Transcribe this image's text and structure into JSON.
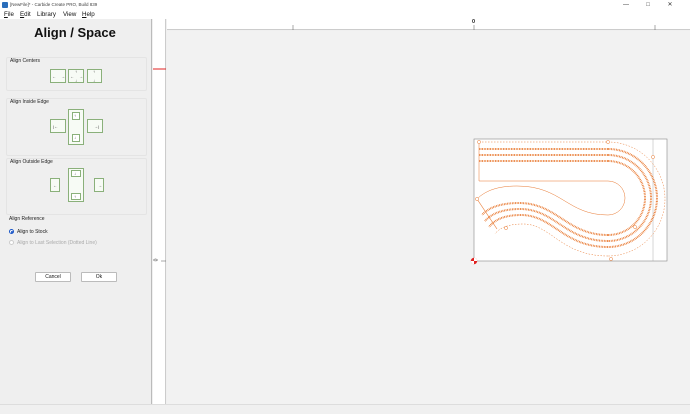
{
  "window": {
    "title": "[NewFile]* - Carbide Create PRO, Build 839",
    "minimize": "—",
    "maximize": "□",
    "close": "✕"
  },
  "menu": {
    "items": [
      {
        "label": "File",
        "key": "F",
        "rest": "ile"
      },
      {
        "label": "Edit",
        "key": "E",
        "rest": "dit"
      },
      {
        "label": "Library",
        "key": "",
        "rest": "Library"
      },
      {
        "label": "View",
        "key": "",
        "rest": "View"
      },
      {
        "label": "Help",
        "key": "H",
        "rest": "elp"
      }
    ]
  },
  "panel": {
    "title": "Align / Space",
    "sections": {
      "centers": "Align Centers",
      "inside": "Align Inside Edge",
      "outside": "Align Outside Edge",
      "reference": "Align Reference"
    },
    "reference_options": [
      {
        "label": "Align to Stock",
        "selected": true,
        "enabled": true
      },
      {
        "label": "Align to Last Selection (Dotted Line)",
        "selected": false,
        "enabled": false
      }
    ],
    "cancel": "Cancel",
    "ok": "Ok"
  },
  "rulers": {
    "h_zero": "0",
    "v_zero": "0"
  },
  "colors": {
    "toolpath": "#e8772e",
    "origin": "#e02020",
    "stock_border": "#888888",
    "button_green": "#8ab07a",
    "radio_blue": "#1a56c7"
  }
}
